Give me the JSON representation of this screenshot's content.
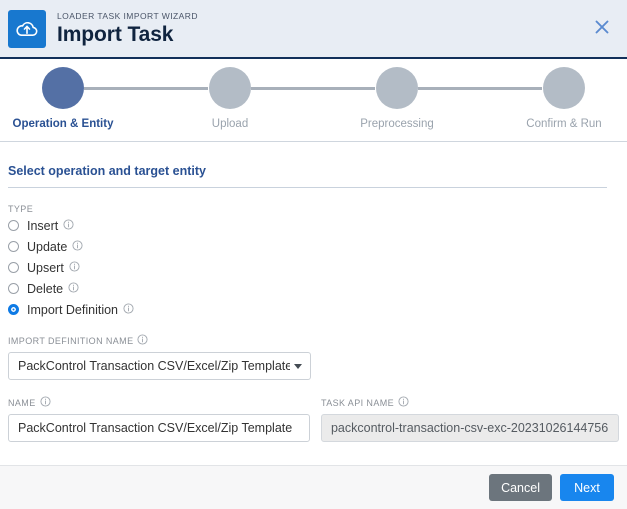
{
  "header": {
    "eyebrow": "LOADER TASK IMPORT WIZARD",
    "title": "Import Task",
    "logo_icon": "cloud-upload-icon",
    "close_icon": "close-icon",
    "accent_color": "#1878cf",
    "background_color": "#e8edf4"
  },
  "stepper": {
    "steps": [
      {
        "label": "Operation & Entity",
        "state": "active"
      },
      {
        "label": "Upload",
        "state": "inactive"
      },
      {
        "label": "Preprocessing",
        "state": "inactive"
      },
      {
        "label": "Confirm & Run",
        "state": "inactive"
      }
    ],
    "active_color": "#5470a5",
    "inactive_color": "#b3bcc6"
  },
  "main": {
    "section_title": "Select operation and target entity",
    "type": {
      "label": "TYPE",
      "options": [
        {
          "label": "Insert",
          "selected": false
        },
        {
          "label": "Update",
          "selected": false
        },
        {
          "label": "Upsert",
          "selected": false
        },
        {
          "label": "Delete",
          "selected": false
        },
        {
          "label": "Import Definition",
          "selected": true
        }
      ]
    },
    "import_definition_name": {
      "label": "IMPORT DEFINITION NAME",
      "value": "PackControl Transaction CSV/Excel/Zip Template"
    },
    "name": {
      "label": "NAME",
      "value": "PackControl Transaction CSV/Excel/Zip Template"
    },
    "task_api_name": {
      "label": "TASK API NAME",
      "value": "packcontrol-transaction-csv-exc-20231026144756",
      "disabled": true
    }
  },
  "footer": {
    "cancel_label": "Cancel",
    "next_label": "Next",
    "cancel_color": "#6c757d",
    "next_color": "#1886ee"
  }
}
